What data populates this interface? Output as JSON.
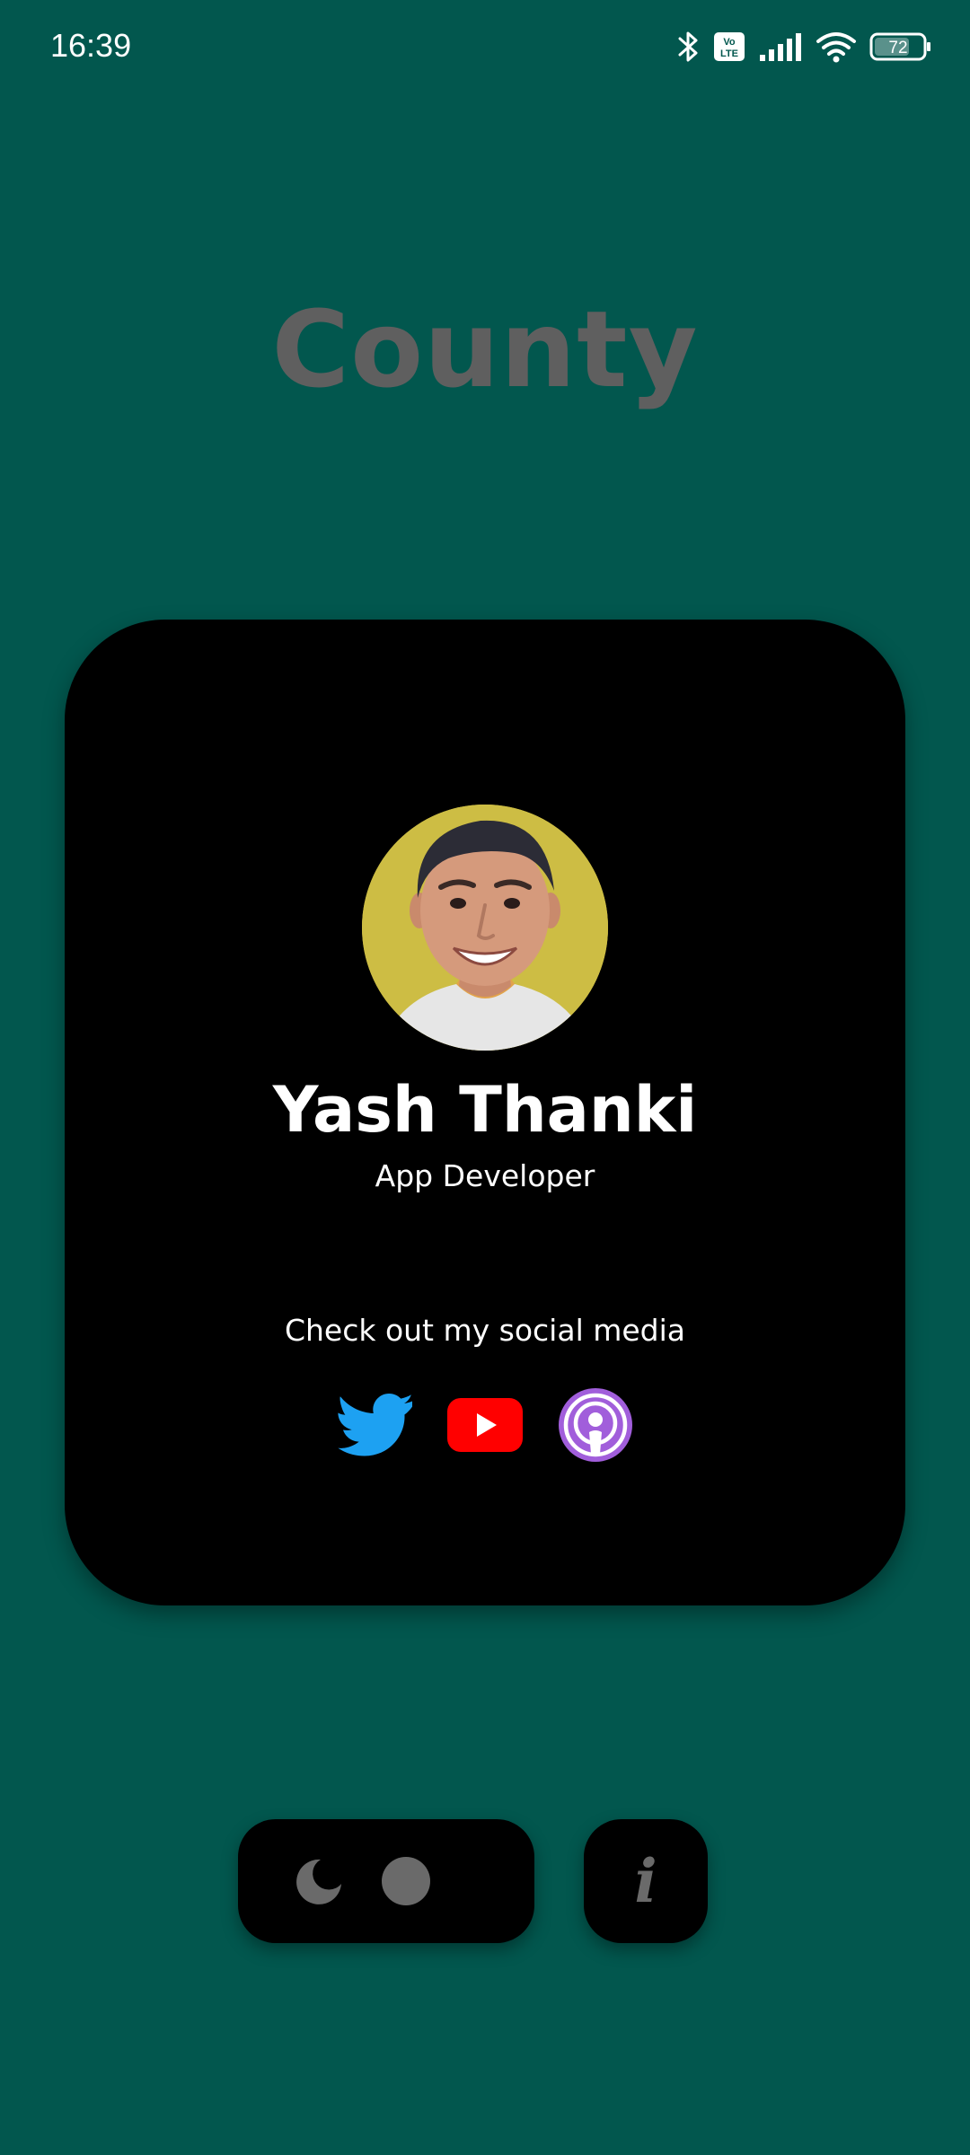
{
  "status_bar": {
    "time": "16:39",
    "battery_level": "72",
    "icons": [
      "bluetooth-icon",
      "volte-icon",
      "signal-icon",
      "wifi-icon",
      "battery-icon"
    ]
  },
  "app": {
    "title": "County"
  },
  "profile": {
    "name": "Yash Thanki",
    "role": "App Developer",
    "avatar_bg": "#cdbd44"
  },
  "social": {
    "heading": "Check out my social media",
    "links": [
      {
        "icon": "twitter-icon",
        "color": "#1da1f2"
      },
      {
        "icon": "youtube-icon",
        "color": "#ff0000"
      },
      {
        "icon": "podcast-icon",
        "color": "#a060d8"
      }
    ]
  },
  "controls": {
    "theme_icons": [
      "moon-icon",
      "sun-icon"
    ],
    "info_label": "i"
  },
  "colors": {
    "background": "#02574e",
    "card": "#000000",
    "title": "#5f5f5f",
    "control_icon": "#6a6a6a"
  }
}
